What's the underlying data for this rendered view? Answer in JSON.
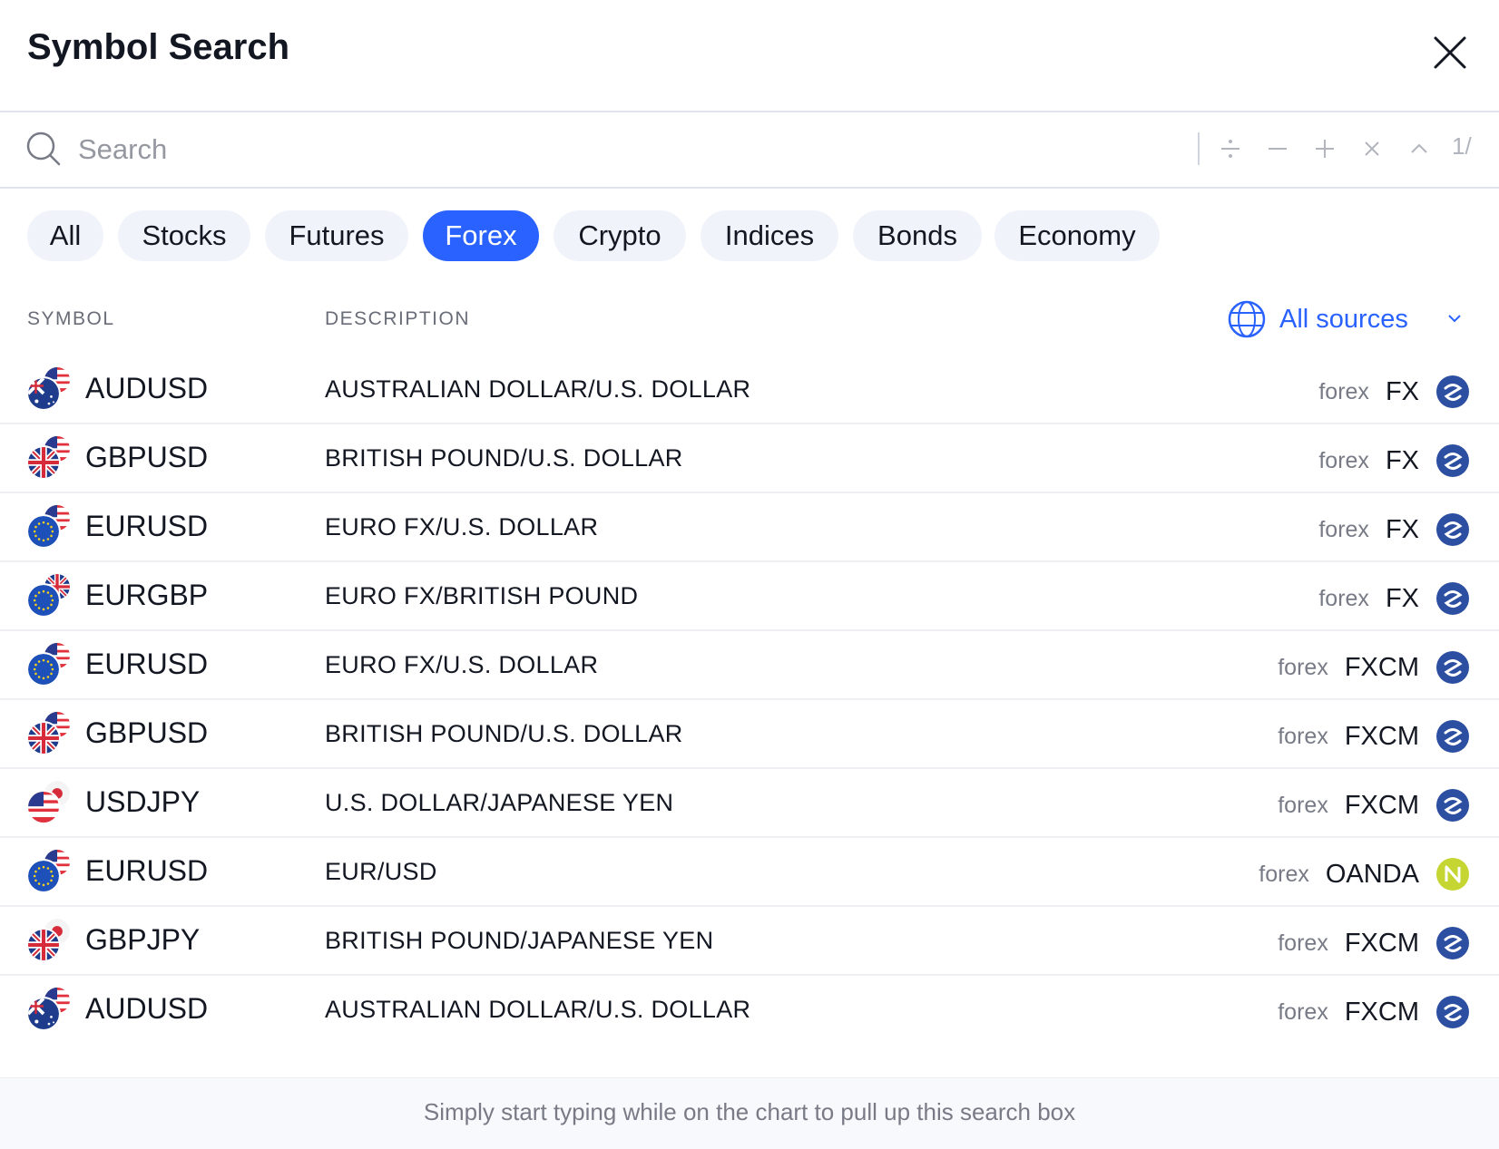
{
  "dialog": {
    "title": "Symbol Search",
    "search_placeholder": "Search",
    "counter": "1/"
  },
  "tabs": [
    {
      "label": "All",
      "active": false
    },
    {
      "label": "Stocks",
      "active": false
    },
    {
      "label": "Futures",
      "active": false
    },
    {
      "label": "Forex",
      "active": true
    },
    {
      "label": "Crypto",
      "active": false
    },
    {
      "label": "Indices",
      "active": false
    },
    {
      "label": "Bonds",
      "active": false
    },
    {
      "label": "Economy",
      "active": false
    }
  ],
  "columns": {
    "symbol": "SYMBOL",
    "description": "DESCRIPTION",
    "sources": "All sources"
  },
  "rows": [
    {
      "symbol": "AUDUSD",
      "description": "AUSTRALIAN DOLLAR/U.S. DOLLAR",
      "type": "forex",
      "exchange": "FX",
      "base": "aud",
      "quote": "usd",
      "provider": "fxcm-icon"
    },
    {
      "symbol": "GBPUSD",
      "description": "BRITISH POUND/U.S. DOLLAR",
      "type": "forex",
      "exchange": "FX",
      "base": "gbp",
      "quote": "usd",
      "provider": "fxcm-icon"
    },
    {
      "symbol": "EURUSD",
      "description": "EURO FX/U.S. DOLLAR",
      "type": "forex",
      "exchange": "FX",
      "base": "eur",
      "quote": "usd",
      "provider": "fxcm-icon"
    },
    {
      "symbol": "EURGBP",
      "description": "EURO FX/BRITISH POUND",
      "type": "forex",
      "exchange": "FX",
      "base": "eur",
      "quote": "gbp",
      "provider": "fxcm-icon"
    },
    {
      "symbol": "EURUSD",
      "description": "EURO FX/U.S. DOLLAR",
      "type": "forex",
      "exchange": "FXCM",
      "base": "eur",
      "quote": "usd",
      "provider": "fxcm-icon"
    },
    {
      "symbol": "GBPUSD",
      "description": "BRITISH POUND/U.S. DOLLAR",
      "type": "forex",
      "exchange": "FXCM",
      "base": "gbp",
      "quote": "usd",
      "provider": "fxcm-icon"
    },
    {
      "symbol": "USDJPY",
      "description": "U.S. DOLLAR/JAPANESE YEN",
      "type": "forex",
      "exchange": "FXCM",
      "base": "usd",
      "quote": "jpy",
      "provider": "fxcm-icon"
    },
    {
      "symbol": "EURUSD",
      "description": "EUR/USD",
      "type": "forex",
      "exchange": "OANDA",
      "base": "eur",
      "quote": "usd",
      "provider": "oanda-icon"
    },
    {
      "symbol": "GBPJPY",
      "description": "BRITISH POUND/JAPANESE YEN",
      "type": "forex",
      "exchange": "FXCM",
      "base": "gbp",
      "quote": "jpy",
      "provider": "fxcm-icon"
    },
    {
      "symbol": "AUDUSD",
      "description": "AUSTRALIAN DOLLAR/U.S. DOLLAR",
      "type": "forex",
      "exchange": "FXCM",
      "base": "aud",
      "quote": "usd",
      "provider": "fxcm-icon"
    }
  ],
  "footer": {
    "hint": "Simply start typing while on the chart to pull up this search box"
  },
  "colors": {
    "accent": "#2962ff",
    "fxcm": "#2c4fa1",
    "oanda": "#c5d633",
    "text": "#131722",
    "muted": "#787b86"
  }
}
